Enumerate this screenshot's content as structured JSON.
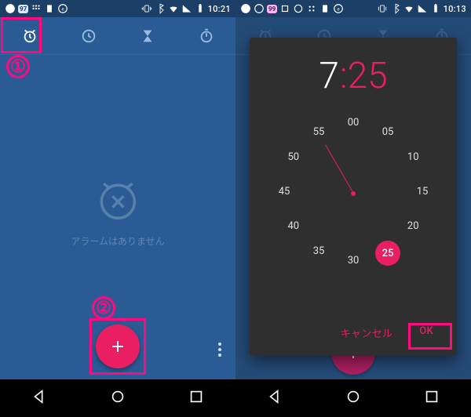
{
  "left": {
    "status_time": "10:21",
    "badge": "97",
    "tabs": [
      "alarm",
      "clock",
      "timer",
      "stopwatch"
    ],
    "empty_text": "アラームはありません",
    "annotation1": "①",
    "annotation2": "②"
  },
  "right": {
    "status_time": "10:13",
    "badge": "99",
    "time_hour": "7",
    "time_colon": ":",
    "time_min": "25",
    "clock_numbers": [
      "00",
      "05",
      "10",
      "15",
      "20",
      "25",
      "30",
      "35",
      "40",
      "45",
      "50",
      "55"
    ],
    "selected_minute": "25",
    "cancel_label": "キャンセル",
    "ok_label": "OK"
  }
}
